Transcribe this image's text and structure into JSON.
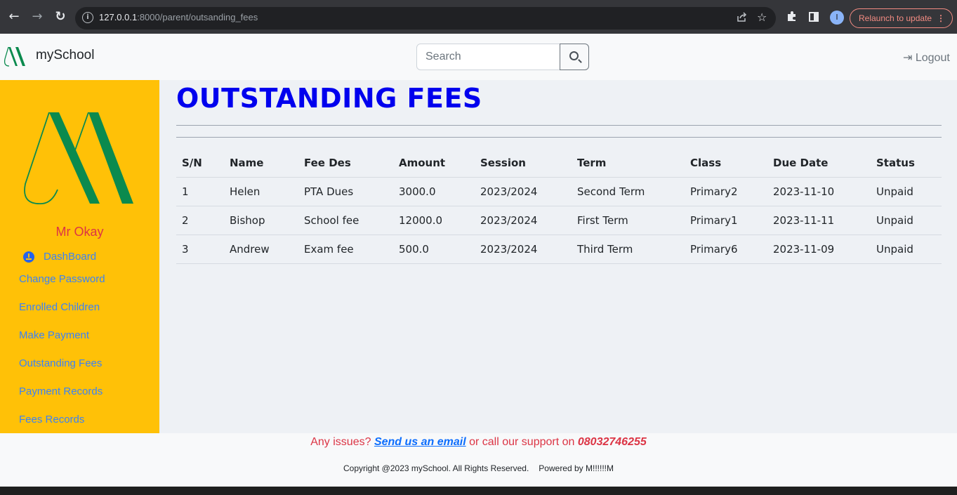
{
  "browser": {
    "back_icon": "←",
    "forward_icon": "→",
    "reload_icon": "↻",
    "url_host": "127.0.0.1",
    "url_rest": ":8000/parent/outsanding_fees",
    "avatar_letter": "I",
    "relaunch_label": "Relaunch to update",
    "menu_dots": "⋮"
  },
  "navbar": {
    "brand": "mySchool",
    "search_placeholder": "Search",
    "logout_label": "Logout"
  },
  "sidebar": {
    "parent_name": "Mr Okay",
    "links": {
      "dashboard": "DashBoard",
      "change_password": "Change Password",
      "enrolled_children": "Enrolled Children",
      "make_payment": "Make Payment",
      "outstanding_fees": "Outstanding Fees",
      "payment_records": "Payment Records",
      "fees_records": "Fees Records"
    }
  },
  "main": {
    "title": "OUTSTANDING FEES",
    "table": {
      "headers": [
        "S/N",
        "Name",
        "Fee Des",
        "Amount",
        "Session",
        "Term",
        "Class",
        "Due Date",
        "Status"
      ],
      "rows": [
        [
          "1",
          "Helen",
          "PTA Dues",
          "3000.0",
          "2023/2024",
          "Second Term",
          "Primary2",
          "2023-11-10",
          "Unpaid"
        ],
        [
          "2",
          "Bishop",
          "School fee",
          "12000.0",
          "2023/2024",
          "First Term",
          "Primary1",
          "2023-11-11",
          "Unpaid"
        ],
        [
          "3",
          "Andrew",
          "Exam fee",
          "500.0",
          "2023/2024",
          "Third Term",
          "Primary6",
          "2023-11-09",
          "Unpaid"
        ]
      ]
    }
  },
  "footer": {
    "issues_text": "Any issues?",
    "email_link": "Send us an email",
    "call_text": "or call our support on",
    "phone": "08032746255",
    "copyright": "Copyright @2023 mySchool. All Rights Reserved.",
    "powered": "Powered by M!!!!!!M"
  },
  "colors": {
    "sidebar_bg": "#ffc107",
    "title_blue": "#0000ee",
    "link_blue": "#3b82f6",
    "red_accent": "#dc3545",
    "logo_green": "#0b8a4e"
  }
}
